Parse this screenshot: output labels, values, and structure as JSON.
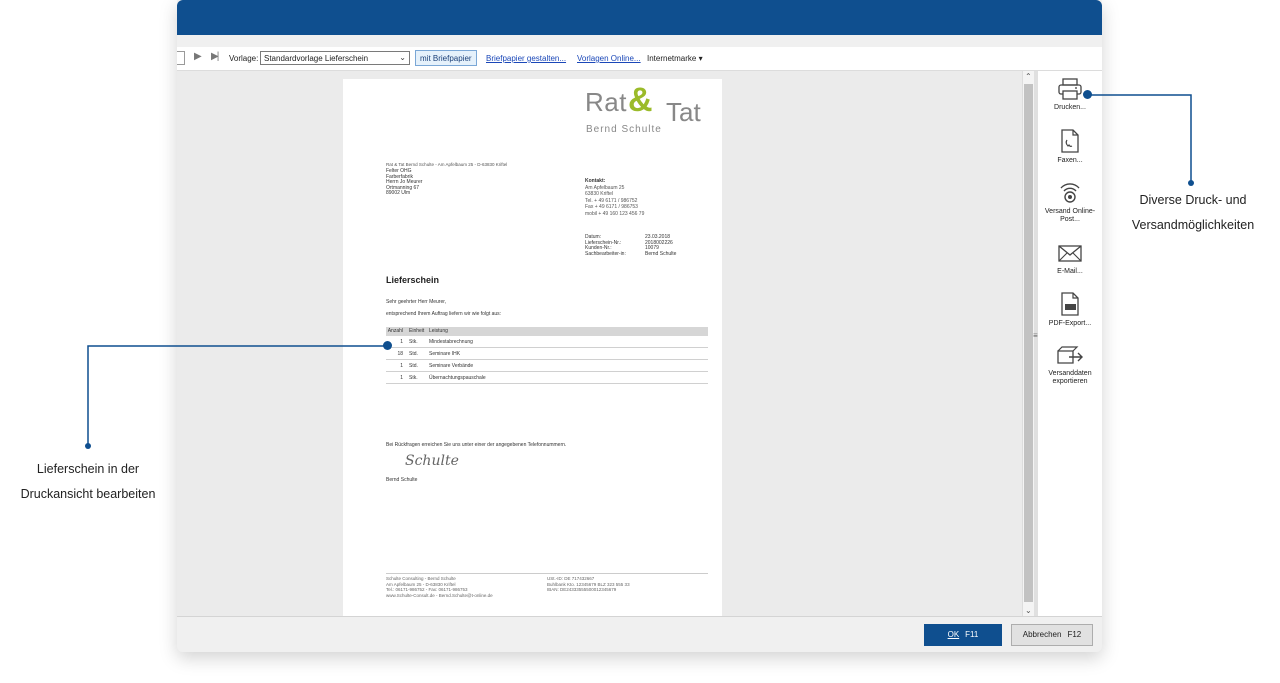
{
  "toolbar": {
    "vorlage_label": "Vorlage:",
    "vorlage_value": "Standardvorlage Lieferschein",
    "briefpapier_button": "mit Briefpapier",
    "link_gestalten": "Briefpapier gestalten...",
    "link_online": "Vorlagen Online...",
    "internetmarke": "Internetmarke"
  },
  "document": {
    "logo_rat": "Rat",
    "logo_amp": "&",
    "logo_tat": "Tat",
    "logo_sub": "Bernd Schulte",
    "sender_line": "Rat & Tat Bernd Schulte - Am Apfelbaum 25 - D-63830 Kriftel",
    "recipient": [
      "Felter OHG",
      "Farberfabrik",
      "Herrn Jo Meurer",
      "Ortmanning 67",
      "89002 Ulm"
    ],
    "kontakt_head": "Kontakt:",
    "kontakt": [
      "Am Apfelbaum 25",
      "63830 Kriftel",
      "Tel. + 49 6171 / 986752",
      "Fax + 49 6171 / 986753",
      "mobil + 49 160 123 456 79"
    ],
    "meta": [
      {
        "k": "Datum:",
        "v": "23.03.2018"
      },
      {
        "k": "Lieferschein-Nr.:",
        "v": "2018002226"
      },
      {
        "k": "Kunden-Nr.:",
        "v": "10079"
      },
      {
        "k": "Sachbearbeiter-in:",
        "v": "Bernd Schulte"
      }
    ],
    "title": "Lieferschein",
    "greeting": "Sehr geehrter Herr Meurer,",
    "intro": "entsprechend Ihrem Auftrag liefern wir wie folgt aus:",
    "table_headers": [
      "Anzahl",
      "Einheit",
      "Leistung"
    ],
    "table_rows": [
      [
        "1",
        "Stk.",
        "Mindestabrechnung"
      ],
      [
        "18",
        "Std.",
        "Seminare IHK"
      ],
      [
        "1",
        "Std.",
        "Seminare Verbände"
      ],
      [
        "1",
        "Stk.",
        "Übernachtungspauschale"
      ]
    ],
    "rueckfragen": "Bei Rückfragen erreichen Sie uns unter einer der angegebenen Telefonnummern.",
    "signature_script": "Schulte",
    "signature_name": "Bernd Schulte",
    "footer_left": [
      "Schulte Consulting - Bernd Schulte",
      "Am Apfelbaum 25 - D-63830 Kriftel",
      "Tel.: 06171-986752 - Fax: 06171-986753",
      "www.Schulte-Consult.de - Bernd.Schulte@t-online.de"
    ],
    "footer_right": [
      "USt.-ID: DE 717432667",
      "Buhlbank Kto. 12345679 BLZ 323 555 33",
      "IBAN: DE24333555500012345679"
    ]
  },
  "actions": [
    {
      "label": "Drucken...",
      "icon": "printer-icon"
    },
    {
      "label": "Faxen...",
      "icon": "fax-icon"
    },
    {
      "label": "Versand Online-Post...",
      "icon": "online-post-icon"
    },
    {
      "label": "E-Mail...",
      "icon": "email-icon"
    },
    {
      "label": "PDF-Export...",
      "icon": "pdf-icon"
    },
    {
      "label": "Versanddaten exportieren",
      "icon": "export-icon"
    }
  ],
  "footer_buttons": {
    "ok_label": "OK",
    "ok_key": "F11",
    "cancel_label": "Abbrechen",
    "cancel_key": "F12"
  },
  "annotations": {
    "left": "Lieferschein in der Druckansicht bearbeiten",
    "right": "Diverse Druck- und Versandmöglichkeiten"
  },
  "colors": {
    "accent": "#0f4f8f",
    "logo_green": "#9bbb2a"
  }
}
